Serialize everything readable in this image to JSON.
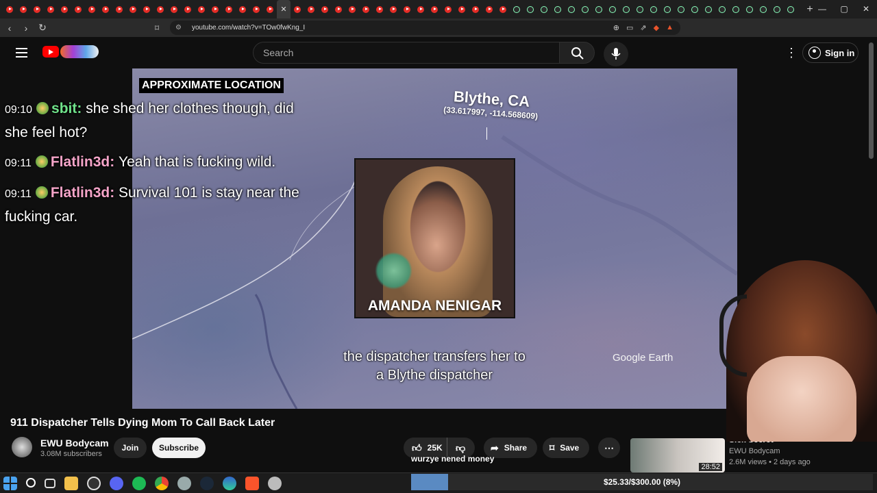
{
  "browser": {
    "url": "youtube.com/watch?v=TOw0fwKng_I"
  },
  "youtube": {
    "search_placeholder": "Search",
    "sign_in": "Sign in"
  },
  "video": {
    "location_tag": "APPROXIMATE LOCATION",
    "city": "Blythe, CA",
    "coords": "(33.617997, -114.568609)",
    "photo_caption": "AMANDA NENIGAR",
    "subtitle": "the dispatcher transfers her to a Blythe dispatcher",
    "watermark": "Google Earth"
  },
  "chat": [
    {
      "time": "09:10",
      "user": "sbit",
      "text": "she shed her clothes though, did she feel hot?"
    },
    {
      "time": "09:11",
      "user": "Flatlin3d",
      "text": "Yeah that is fucking wild."
    },
    {
      "time": "09:11",
      "user": "Flatlin3d",
      "text": "Survival 101 is stay near the fucking car."
    }
  ],
  "details": {
    "title": "911 Dispatcher Tells Dying Mom To Call Back Later",
    "channel": "EWU Bodycam",
    "subscribers": "3.08M subscribers",
    "join": "Join",
    "subscribe": "Subscribe",
    "likes": "25K",
    "share": "Share",
    "save": "Save"
  },
  "recommended": {
    "title": "Sick Secret",
    "channel": "EWU Bodycam",
    "meta": "2.6M views • 2 days ago",
    "duration": "28:52"
  },
  "stream_overlay": {
    "chat_line": "wurzye nened money",
    "goal_text": "$25.33/$300.00 (8%)",
    "goal_fraction": 0.08
  },
  "colors": {
    "yt_red": "#ff0000",
    "user_sbit": "#6fe28a",
    "user_flatlin": "#f4a4c8"
  }
}
